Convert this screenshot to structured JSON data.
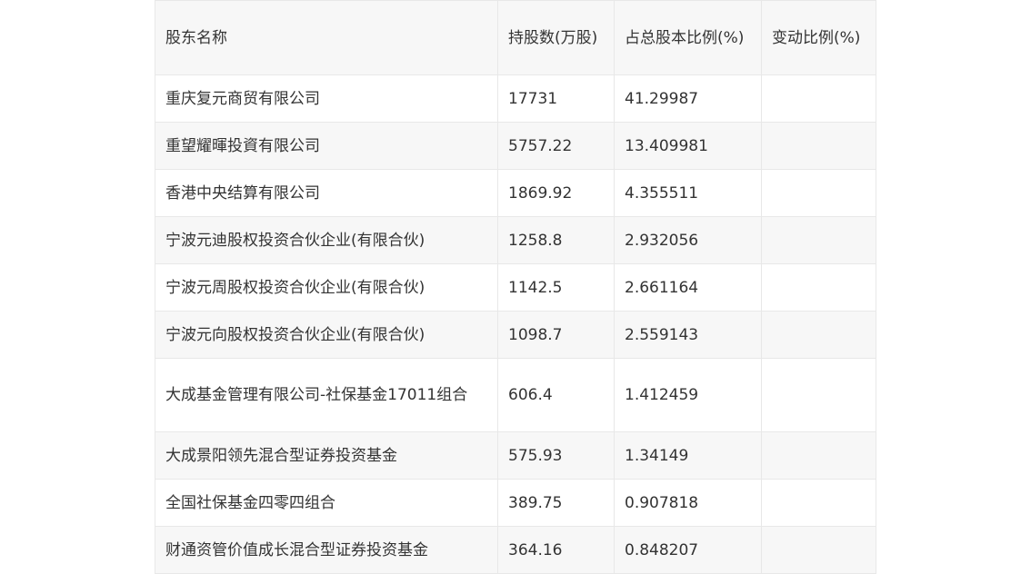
{
  "table": {
    "headers": [
      "股东名称",
      "持股数(万股)",
      "占总股本比例(%)",
      "变动比例(%)"
    ],
    "rows": [
      [
        "重庆复元商贸有限公司",
        "17731",
        "41.29987",
        ""
      ],
      [
        "重望耀暉投資有限公司",
        "5757.22",
        "13.409981",
        ""
      ],
      [
        "香港中央结算有限公司",
        "1869.92",
        "4.355511",
        ""
      ],
      [
        "宁波元迪股权投资合伙企业(有限合伙)",
        "1258.8",
        "2.932056",
        ""
      ],
      [
        "宁波元周股权投资合伙企业(有限合伙)",
        "1142.5",
        "2.661164",
        ""
      ],
      [
        "宁波元向股权投资合伙企业(有限合伙)",
        "1098.7",
        "2.559143",
        ""
      ],
      [
        "大成基金管理有限公司-社保基金17011组合",
        "606.4",
        "1.412459",
        ""
      ],
      [
        "大成景阳领先混合型证券投资基金",
        "575.93",
        "1.34149",
        ""
      ],
      [
        "全国社保基金四零四组合",
        "389.75",
        "0.907818",
        ""
      ],
      [
        "财通资管价值成长混合型证券投资基金",
        "364.16",
        "0.848207",
        ""
      ]
    ]
  }
}
